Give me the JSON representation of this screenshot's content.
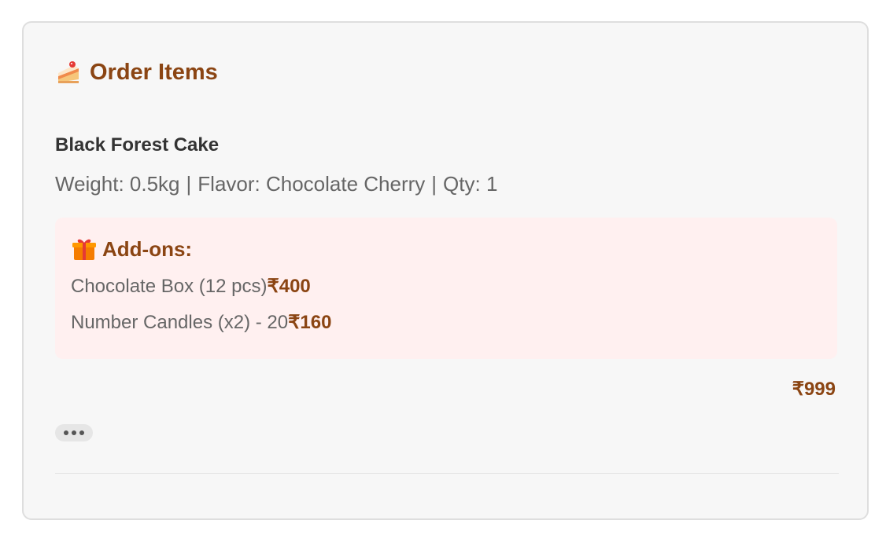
{
  "order": {
    "heading": "Order Items",
    "heading_icon": "cake-slice-icon",
    "item": {
      "name": "Black Forest Cake",
      "weight": "Weight: 0.5kg",
      "sep1": "|",
      "flavor": "Flavor: Chocolate Cherry",
      "sep2": "|",
      "qty": "Qty: 1"
    },
    "addons": {
      "title": "Add-ons:",
      "icon": "gift-icon",
      "items": [
        {
          "label": "Chocolate Box (12 pcs)",
          "price": "₹400"
        },
        {
          "label": "Number Candles (x2) - 20",
          "price": "₹160"
        }
      ]
    },
    "total": "₹999",
    "more_icon": "ellipsis-icon"
  },
  "colors": {
    "accent": "#8b4513",
    "card_bg": "#f7f7f7",
    "addons_bg": "#fff0f0",
    "text_dark": "#333333",
    "text_muted": "#666666"
  }
}
